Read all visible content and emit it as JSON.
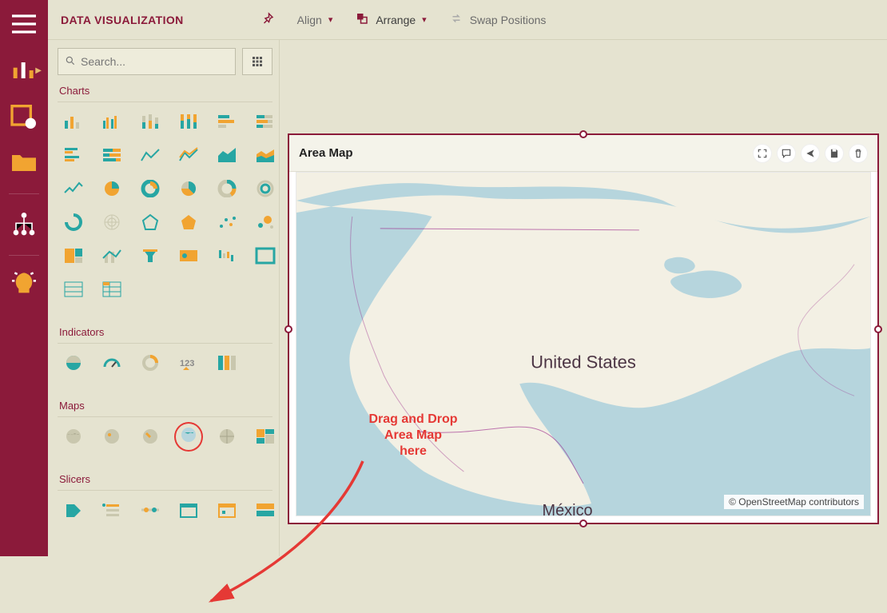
{
  "header": {
    "title": "DATA VISUALIZATION",
    "align_label": "Align",
    "arrange_label": "Arrange",
    "swap_label": "Swap Positions"
  },
  "search": {
    "placeholder": "Search..."
  },
  "sections": {
    "charts": "Charts",
    "indicators": "Indicators",
    "maps": "Maps",
    "slicers": "Slicers"
  },
  "widget": {
    "title": "Area Map"
  },
  "map": {
    "label_us": "United States",
    "label_mx": "México",
    "attribution": "© OpenStreetMap contributors"
  },
  "annotation": {
    "line1": "Drag and Drop",
    "line2": "Area Map",
    "line3": "here"
  },
  "colors": {
    "brand": "#8b1a3a",
    "accent_teal": "#27a6a3",
    "accent_gold": "#f1a431",
    "annotation_red": "#e53935"
  },
  "rail_items": [
    "menu",
    "dashboard",
    "user-report",
    "folder",
    "tree",
    "discover"
  ]
}
